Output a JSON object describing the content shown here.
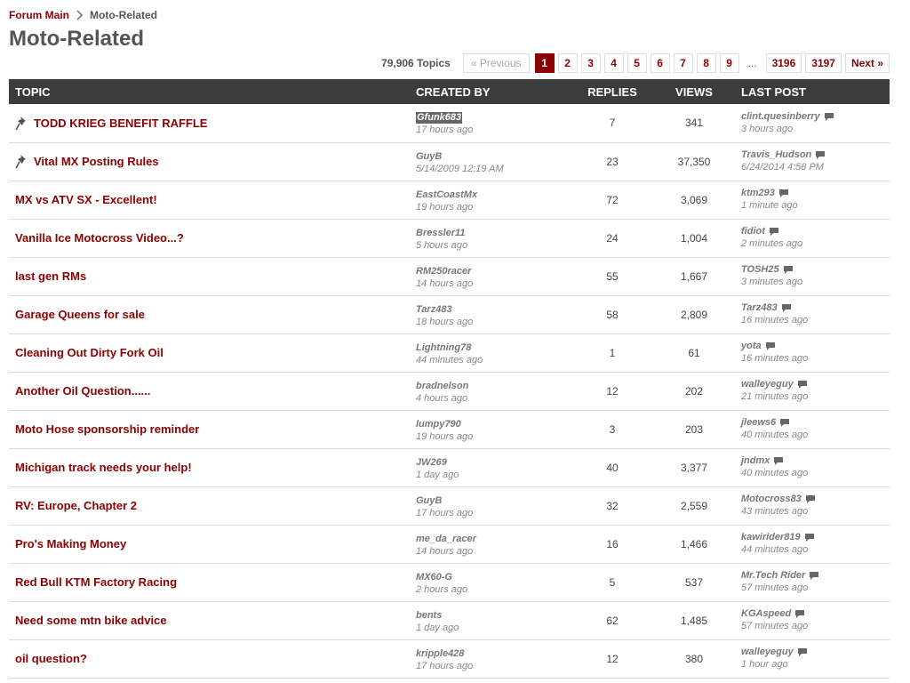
{
  "breadcrumb": {
    "root": "Forum Main",
    "current": "Moto-Related"
  },
  "page_title": "Moto-Related",
  "pagination": {
    "topic_count": "79,906 Topics",
    "previous": "« Previous",
    "pages": [
      "1",
      "2",
      "3",
      "4",
      "5",
      "6",
      "7",
      "8",
      "9"
    ],
    "ellipsis": "...",
    "last_pages": [
      "3196",
      "3197"
    ],
    "next": "Next »",
    "current_page": "1"
  },
  "columns": {
    "topic": "TOPIC",
    "created_by": "CREATED BY",
    "replies": "REPLIES",
    "views": "VIEWS",
    "last_post": "LAST POST"
  },
  "topics": [
    {
      "title": "TODD KRIEG BENEFIT RAFFLE",
      "pinned": true,
      "creator": "Gfunk683",
      "created": "17 hours ago",
      "replies": "7",
      "views": "341",
      "last_user": "clint.quesinberry",
      "last_time": "3 hours ago"
    },
    {
      "title": "Vital MX Posting Rules",
      "pinned": true,
      "creator": "GuyB",
      "created": "5/14/2009 12:19 AM",
      "replies": "23",
      "views": "37,350",
      "last_user": "Travis_Hudson",
      "last_time": "6/24/2014 4:58 PM"
    },
    {
      "title": "MX vs ATV SX - Excellent!",
      "pinned": false,
      "creator": "EastCoastMx",
      "created": "19 hours ago",
      "replies": "72",
      "views": "3,069",
      "last_user": "ktm293",
      "last_time": "1 minute ago"
    },
    {
      "title": "Vanilla Ice Motocross Video...?",
      "pinned": false,
      "creator": "Bressler11",
      "created": "5 hours ago",
      "replies": "24",
      "views": "1,004",
      "last_user": "fidiot",
      "last_time": "2 minutes ago"
    },
    {
      "title": "last gen RMs",
      "pinned": false,
      "creator": "RM250racer",
      "created": "14 hours ago",
      "replies": "55",
      "views": "1,667",
      "last_user": "TOSH25",
      "last_time": "3 minutes ago"
    },
    {
      "title": "Garage Queens for sale",
      "pinned": false,
      "creator": "Tarz483",
      "created": "18 hours ago",
      "replies": "58",
      "views": "2,809",
      "last_user": "Tarz483",
      "last_time": "16 minutes ago"
    },
    {
      "title": "Cleaning Out Dirty Fork Oil",
      "pinned": false,
      "creator": "Lightning78",
      "created": "44 minutes ago",
      "replies": "1",
      "views": "61",
      "last_user": "yota",
      "last_time": "16 minutes ago"
    },
    {
      "title": "Another Oil Question......",
      "pinned": false,
      "creator": "bradnelson",
      "created": "4 hours ago",
      "replies": "12",
      "views": "202",
      "last_user": "walleyeguy",
      "last_time": "21 minutes ago"
    },
    {
      "title": "Moto Hose sponsorship reminder",
      "pinned": false,
      "creator": "lumpy790",
      "created": "19 hours ago",
      "replies": "3",
      "views": "203",
      "last_user": "jleews6",
      "last_time": "40 minutes ago"
    },
    {
      "title": "Michigan track needs your help!",
      "pinned": false,
      "creator": "JW269",
      "created": "1 day ago",
      "replies": "40",
      "views": "3,377",
      "last_user": "jndmx",
      "last_time": "40 minutes ago"
    },
    {
      "title": "RV: Europe, Chapter 2",
      "pinned": false,
      "creator": "GuyB",
      "created": "17 hours ago",
      "replies": "32",
      "views": "2,559",
      "last_user": "Motocross83",
      "last_time": "43 minutes ago"
    },
    {
      "title": "Pro's Making Money",
      "pinned": false,
      "creator": "me_da_racer",
      "created": "14 hours ago",
      "replies": "16",
      "views": "1,466",
      "last_user": "kawirider819",
      "last_time": "44 minutes ago"
    },
    {
      "title": "Red Bull KTM Factory Racing",
      "pinned": false,
      "creator": "MX60-G",
      "created": "2 hours ago",
      "replies": "5",
      "views": "537",
      "last_user": "Mr.Tech Rider",
      "last_time": "57 minutes ago"
    },
    {
      "title": "Need some mtn bike advice",
      "pinned": false,
      "creator": "bents",
      "created": "1 day ago",
      "replies": "62",
      "views": "1,485",
      "last_user": "KGAspeed",
      "last_time": "57 minutes ago"
    },
    {
      "title": "oil question?",
      "pinned": false,
      "creator": "kripple428",
      "created": "17 hours ago",
      "replies": "12",
      "views": "380",
      "last_user": "walleyeguy",
      "last_time": "1 hour ago"
    }
  ],
  "icons": {
    "pin": "pin-icon",
    "chat": "chat-bubble-icon",
    "separator": "chevron-right-icon"
  },
  "colors": {
    "accent": "#8b0000",
    "header_bg": "#3c3c3c",
    "muted_text": "#777777"
  }
}
